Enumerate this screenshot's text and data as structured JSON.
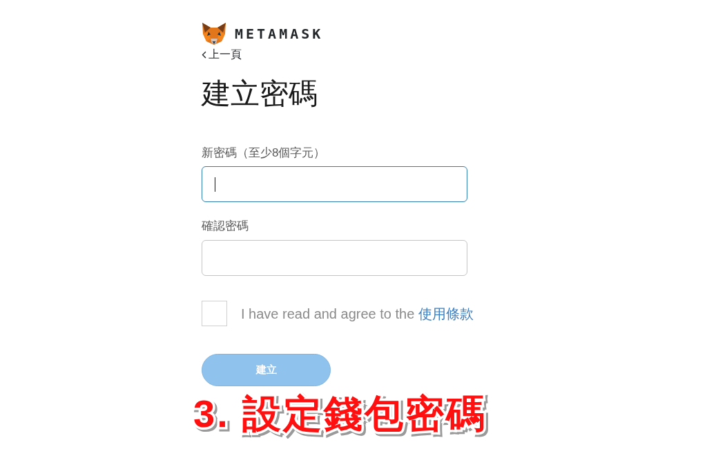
{
  "logo": {
    "wordmark": "METAMASK"
  },
  "back_link": {
    "label": "上一頁"
  },
  "title": "建立密碼",
  "fields": [
    {
      "label": "新密碼（至少8個字元）",
      "focused": true
    },
    {
      "label": "確認密碼",
      "focused": false
    }
  ],
  "terms": {
    "checked": false,
    "text": "I have read and agree to the",
    "link": "使用條款"
  },
  "submit": {
    "label": "建立",
    "disabled": true
  },
  "caption": "3. 設定錢包密碼"
}
